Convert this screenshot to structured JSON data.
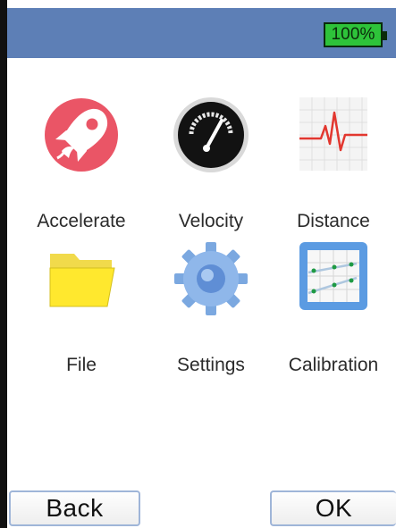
{
  "status_bar": {
    "battery_text": "100%",
    "background_color": "#5d7fb6",
    "battery_color": "#2ec33a"
  },
  "apps": [
    {
      "label": "Accelerate",
      "icon": "rocket-icon"
    },
    {
      "label": "Velocity",
      "icon": "speedometer-icon"
    },
    {
      "label": "Distance",
      "icon": "waveform-icon"
    },
    {
      "label": "File",
      "icon": "folder-icon"
    },
    {
      "label": "Settings",
      "icon": "gear-icon"
    },
    {
      "label": "Calibration",
      "icon": "calibration-chart-icon"
    }
  ],
  "footer": {
    "back_label": "Back",
    "ok_label": "OK"
  }
}
